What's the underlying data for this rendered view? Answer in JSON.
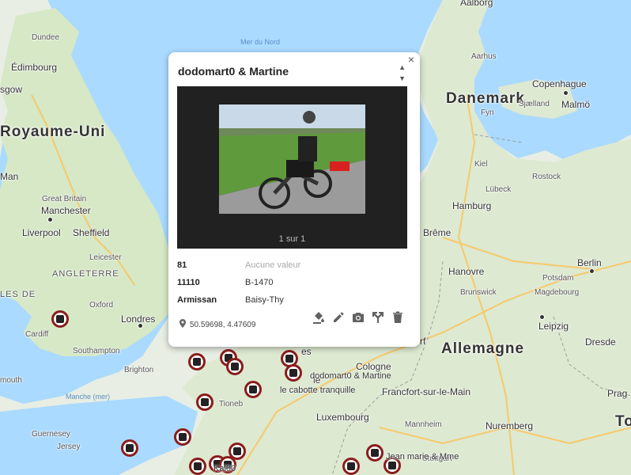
{
  "map": {
    "water_labels": [
      "Mer du Nord",
      "Manche (mer)"
    ],
    "countries": [
      "Royaume-Uni",
      "Danemark",
      "Allemagne"
    ],
    "regions": [
      "ANGLETERRE",
      "LES DE"
    ],
    "cities": [
      "Aalborg",
      "Dundee",
      "Édimbourg",
      "sgow",
      "Aarhus",
      "Copenhague",
      "Sjælland",
      "Malmö",
      "Fyn",
      "Kiel",
      "Rostock",
      "Lübeck",
      "Hamburg",
      "Brême",
      "Man",
      "Great Britain",
      "Manchester",
      "Liverpool",
      "Sheffield",
      "Leicester",
      "Hanovre",
      "Berlin",
      "Potsdam",
      "Brunswick",
      "Magdebourg",
      "Oxford",
      "Londres",
      "Cardiff",
      "Leipzig",
      "Dresde",
      "Southampton",
      "Brighton",
      "mouth",
      "Cologne",
      "Francfort-sur-le-Main",
      "Prag",
      "Tioneb",
      "Luxembourg",
      "Mannheim",
      "Nuremberg",
      "Guernesey",
      "Jersey",
      "Stuttgart",
      "To",
      "es",
      "rf",
      "le"
    ],
    "marker_labels": [
      "dodomart0 & Martine",
      "le cabotte tranquille",
      "Jean marie & Mme",
      "Kal00"
    ]
  },
  "popup": {
    "close_label": "×",
    "title": "dodomart0 & Martine",
    "gallery_counter": "1 sur 1",
    "fields": [
      {
        "key": "81",
        "value": "Aucune valeur",
        "empty": true
      },
      {
        "key": "11110",
        "value": "B-1470",
        "empty": false
      },
      {
        "key": "Armissan",
        "value": "Baisy-Thy",
        "empty": false
      }
    ],
    "coords": "50.59698, 4.47609",
    "tools": [
      "paint-bucket-icon",
      "pencil-icon",
      "camera-icon",
      "directions-icon",
      "trash-icon"
    ]
  }
}
